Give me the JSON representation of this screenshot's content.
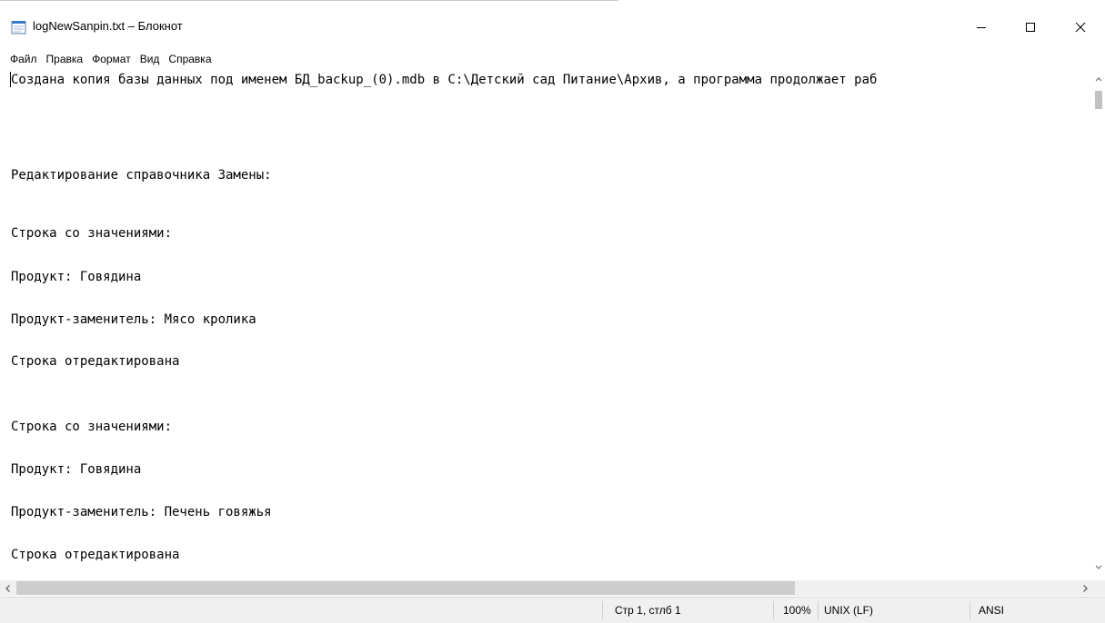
{
  "window": {
    "title": "logNewSanpin.txt – Блокнот",
    "controls": {
      "minimize": "—",
      "maximize": "☐",
      "close": "✕"
    }
  },
  "menu": {
    "items": [
      "Файл",
      "Правка",
      "Формат",
      "Вид",
      "Справка"
    ]
  },
  "editor": {
    "lines": [
      "Создана копия базы данных под именем БД_backup_(0).mdb в C:\\Детский сад Питание\\Архив, а программа продолжает раб",
      "",
      "",
      "Редактирование справочника Замены:",
      "",
      "Строка со значениями:",
      "",
      "Продукт: Говядина",
      "",
      "Продукт-заменитель: Мясо кролика",
      "",
      "Строка отредактирована",
      "",
      "",
      "Строка со значениями:",
      "",
      "Продукт: Говядина",
      "",
      "Продукт-заменитель: Печень говяжья",
      "",
      "Строка отредактирована"
    ]
  },
  "status": {
    "position": "Стр 1, стлб 1",
    "zoom": "100%",
    "line_ending": "UNIX (LF)",
    "encoding": "ANSI"
  },
  "icons": {
    "app": "notepad-icon",
    "scroll_left": "chevron-left-icon",
    "scroll_right": "chevron-right-icon",
    "scroll_up": "chevron-up-icon",
    "scroll_down": "chevron-down-icon"
  }
}
